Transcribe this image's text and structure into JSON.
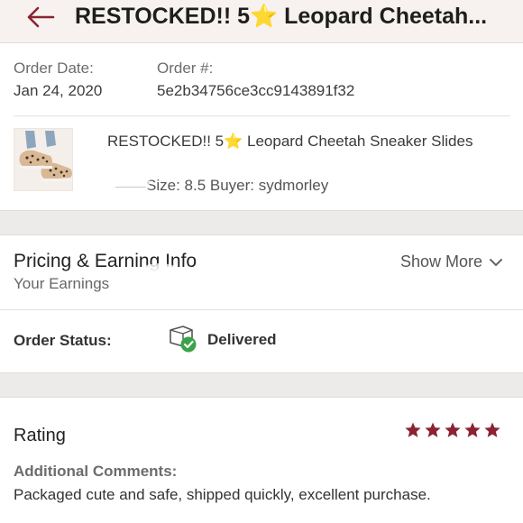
{
  "header": {
    "title": "RESTOCKED!! 5⭐️ Leopard Cheetah..."
  },
  "order": {
    "date_label": "Order Date:",
    "date_value": "Jan 24, 2020",
    "number_label": "Order #:",
    "number_value": "5e2b34756ce3cc9143891f32"
  },
  "item": {
    "title": "RESTOCKED!! 5⭐️ Leopard Cheetah Sneaker Slides",
    "meta": "Size: 8.5 Buyer: sydmorley"
  },
  "pricing": {
    "title": "Pricing & Earning Info",
    "earnings_label": "Your Earnings",
    "show_more_label": "Show More"
  },
  "status": {
    "label": "Order Status:",
    "value": "Delivered",
    "icon": "delivered-box-check-icon",
    "accent": "#3aa34a"
  },
  "rating": {
    "title": "Rating",
    "stars": 5,
    "max_stars": 5,
    "star_color": "#8b2333",
    "comments_label": "Additional Comments:",
    "comments_text": "Packaged cute and safe, shipped quickly, excellent purchase."
  },
  "colors": {
    "brand": "#8b2333",
    "header_bg": "#f7f2ef",
    "section_band": "#ecebea"
  }
}
